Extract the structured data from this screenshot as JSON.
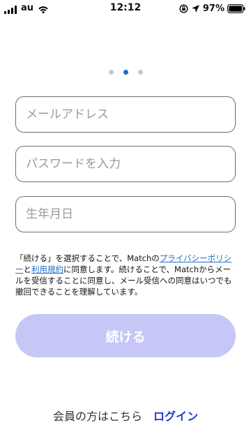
{
  "status_bar": {
    "carrier": "au",
    "time": "12:12",
    "battery": "97%"
  },
  "pagination": {
    "count": 3,
    "active_index": 1
  },
  "form": {
    "email_placeholder": "メールアドレス",
    "password_placeholder": "パスワードを入力",
    "birthday_placeholder": "生年月日"
  },
  "terms": {
    "part1": "「続ける」を選択することで、Matchの",
    "privacy_link": "プライバシーポリシー",
    "part2": "と",
    "terms_link": "利用規約",
    "part3": "に同意します。続けることで、Matchからメールを受信することに同意し、メール受信への同意はいつでも撤回できることを理解しています。"
  },
  "continue_button": {
    "label": "続ける"
  },
  "login": {
    "prompt": "会員の方はこちら",
    "link_label": "ログイン"
  },
  "colors": {
    "accent": "#1b6ec8",
    "button_disabled": "#c6c7f7",
    "login_link": "#1b3bd6"
  },
  "icons": [
    "signal-icon",
    "wifi-icon",
    "rotation-lock-icon",
    "location-arrow-icon",
    "battery-icon"
  ]
}
